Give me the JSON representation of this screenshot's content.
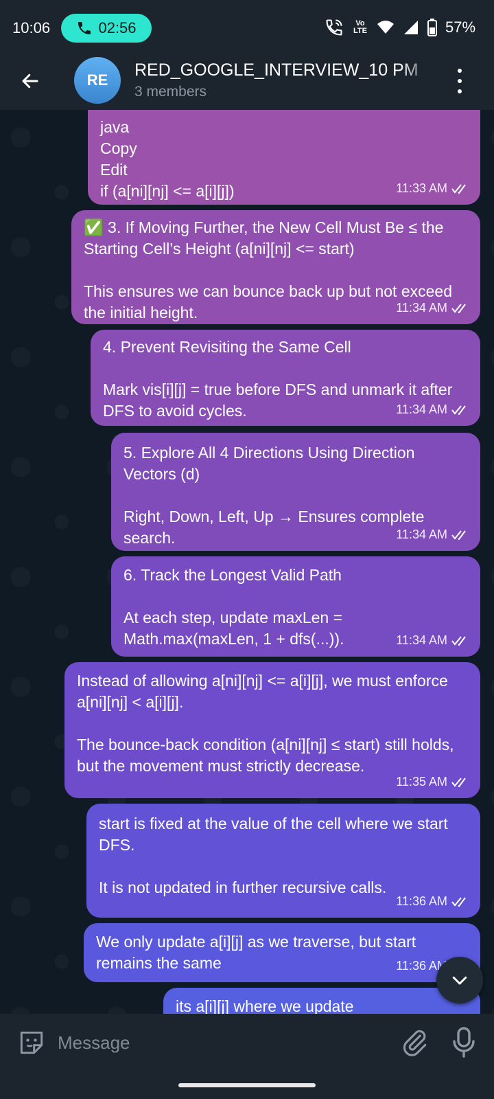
{
  "status": {
    "time": "10:06",
    "call_duration": "02:56",
    "battery": "57%",
    "network_label": "Vo LTE"
  },
  "header": {
    "avatar_initials": "RE",
    "title": "RED_GOOGLE_INTERVIEW_10 PM",
    "subtitle": "3 members"
  },
  "messages": [
    {
      "text": "java\nCopy\nEdit\nif (a[ni][nj] <= a[i][j])",
      "time": "11:33 AM",
      "color": "#9a52ab"
    },
    {
      "text": "✅ 3. If Moving Further, the New Cell Must Be ≤ the Starting Cell’s Height (a[ni][nj] <= start)\n\nThis ensures we can bounce back up but not exceed the initial height.",
      "time": "11:34 AM",
      "color": "#9150b0"
    },
    {
      "text": "4. Prevent Revisiting the Same Cell\n\nMark vis[i][j] = true before DFS and unmark it after DFS to avoid cycles.",
      "time": "11:34 AM",
      "color": "#884eb5"
    },
    {
      "text": "5. Explore All 4 Directions Using Direction Vectors (d)\n\nRight, Down, Left, Up → Ensures complete search.",
      "time": "11:34 AM",
      "color": "#7f4cba"
    },
    {
      "text": "6. Track the Longest Valid Path\n\nAt each step, update maxLen =\nMath.max(maxLen, 1 + dfs(...)).",
      "time": "11:34 AM",
      "color": "#774bc2"
    },
    {
      "text": "Instead of allowing a[ni][nj] <= a[i][j], we must enforce a[ni][nj] < a[i][j].\n\nThe bounce-back condition (a[ni][nj] ≤ start) still holds, but the movement must strictly decrease.",
      "time": "11:35 AM",
      "color": "#6e4ccc"
    },
    {
      "text": "start is fixed at the value of the cell where we start DFS.\n\nIt is not updated in further recursive calls.",
      "time": "11:36 AM",
      "color": "#6152d6"
    },
    {
      "text": "We only update a[i][j] as we traverse, but start remains the same",
      "time": "11:36 AM",
      "color": "#5a58dc"
    },
    {
      "text": "its a[i][j] where we update",
      "time": "",
      "color": "#5460e0"
    }
  ],
  "input": {
    "placeholder": "Message"
  },
  "icons": {
    "back": "arrow-left-icon",
    "call": "phone-icon",
    "menu": "more-vertical-icon",
    "sticker": "sticker-icon",
    "attach": "paperclip-icon",
    "mic": "microphone-icon",
    "scroll": "chevron-down-icon"
  }
}
